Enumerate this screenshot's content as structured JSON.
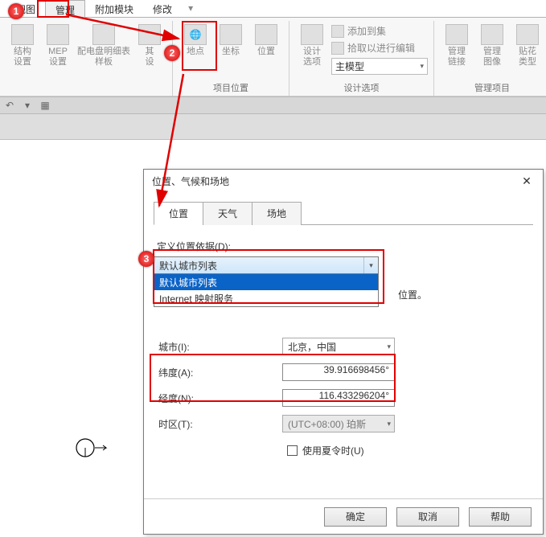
{
  "menu": {
    "tabs": [
      "视图",
      "管理",
      "附加模块",
      "修改"
    ],
    "active": "管理"
  },
  "ribbon": {
    "groups": [
      {
        "items": [
          {
            "label": "结构\n设置"
          },
          {
            "label": "MEP\n设置"
          },
          {
            "label": "配电盘明细表\n样板"
          },
          {
            "label": "其\n设"
          }
        ],
        "title": ""
      },
      {
        "items": [
          {
            "label": "地点"
          },
          {
            "label": "坐标"
          },
          {
            "label": "位置"
          }
        ],
        "title": "项目位置"
      },
      {
        "items_small": [
          "添加到集",
          "拾取以进行编辑"
        ],
        "big_icon": "设计\n选项",
        "dropdown": "主模型",
        "title": "设计选项"
      },
      {
        "items": [
          {
            "label": "管理\n链接"
          },
          {
            "label": "管理\n图像"
          },
          {
            "label": "贴花\n类型"
          }
        ],
        "title": "管理项目"
      }
    ]
  },
  "dialog": {
    "title": "位置、气候和场地",
    "tabs": [
      "位置",
      "天气",
      "场地"
    ],
    "active_tab": "位置",
    "define_label": "定义位置依据(D):",
    "combo_selected": "默认城市列表",
    "combo_options": [
      "默认城市列表",
      "Internet 映射服务"
    ],
    "info_tail": "位置。",
    "rows": {
      "city_label": "城市(I):",
      "city_value": "北京，中国",
      "lat_label": "纬度(A):",
      "lat_value": "39.916698456°",
      "lon_label": "经度(N):",
      "lon_value": "116.433296204°",
      "tz_label": "时区(T):",
      "tz_value": "(UTC+08:00) 珀斯"
    },
    "dst": "使用夏令时(U)",
    "buttons": {
      "ok": "确定",
      "cancel": "取消",
      "help": "帮助"
    }
  },
  "callouts": [
    "1",
    "2",
    "3"
  ]
}
